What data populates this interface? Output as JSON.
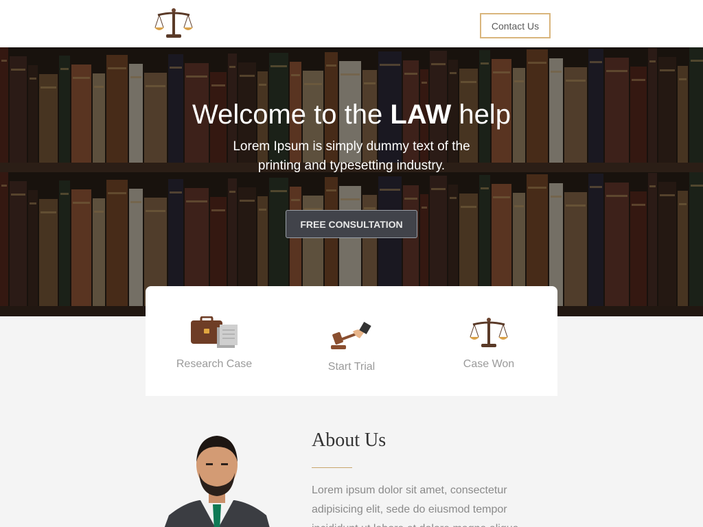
{
  "header": {
    "logo_icon": "scales-of-justice-icon",
    "contact_label": "Contact Us"
  },
  "hero": {
    "title_pre": "Welcome to the ",
    "title_bold": "LAW",
    "title_post": " help",
    "subtitle": "Lorem Ipsum is simply dummy text of the printing and typesetting industry.",
    "cta_label": "FREE CONSULTATION"
  },
  "features": [
    {
      "icon": "briefcase-documents-icon",
      "label": "Research Case"
    },
    {
      "icon": "gavel-icon",
      "label": "Start Trial"
    },
    {
      "icon": "scales-of-justice-icon",
      "label": "Case Won"
    }
  ],
  "about": {
    "title": "About Us",
    "text": "Lorem ipsum dolor sit amet, consectetur adipisicing elit, sede do eiusmod tempor incididunt ut labore et dolore magna aliqua"
  },
  "colors": {
    "accent": "#d9b57c",
    "cta_bg": "#41434a",
    "page_bg": "#f4f4f4"
  }
}
